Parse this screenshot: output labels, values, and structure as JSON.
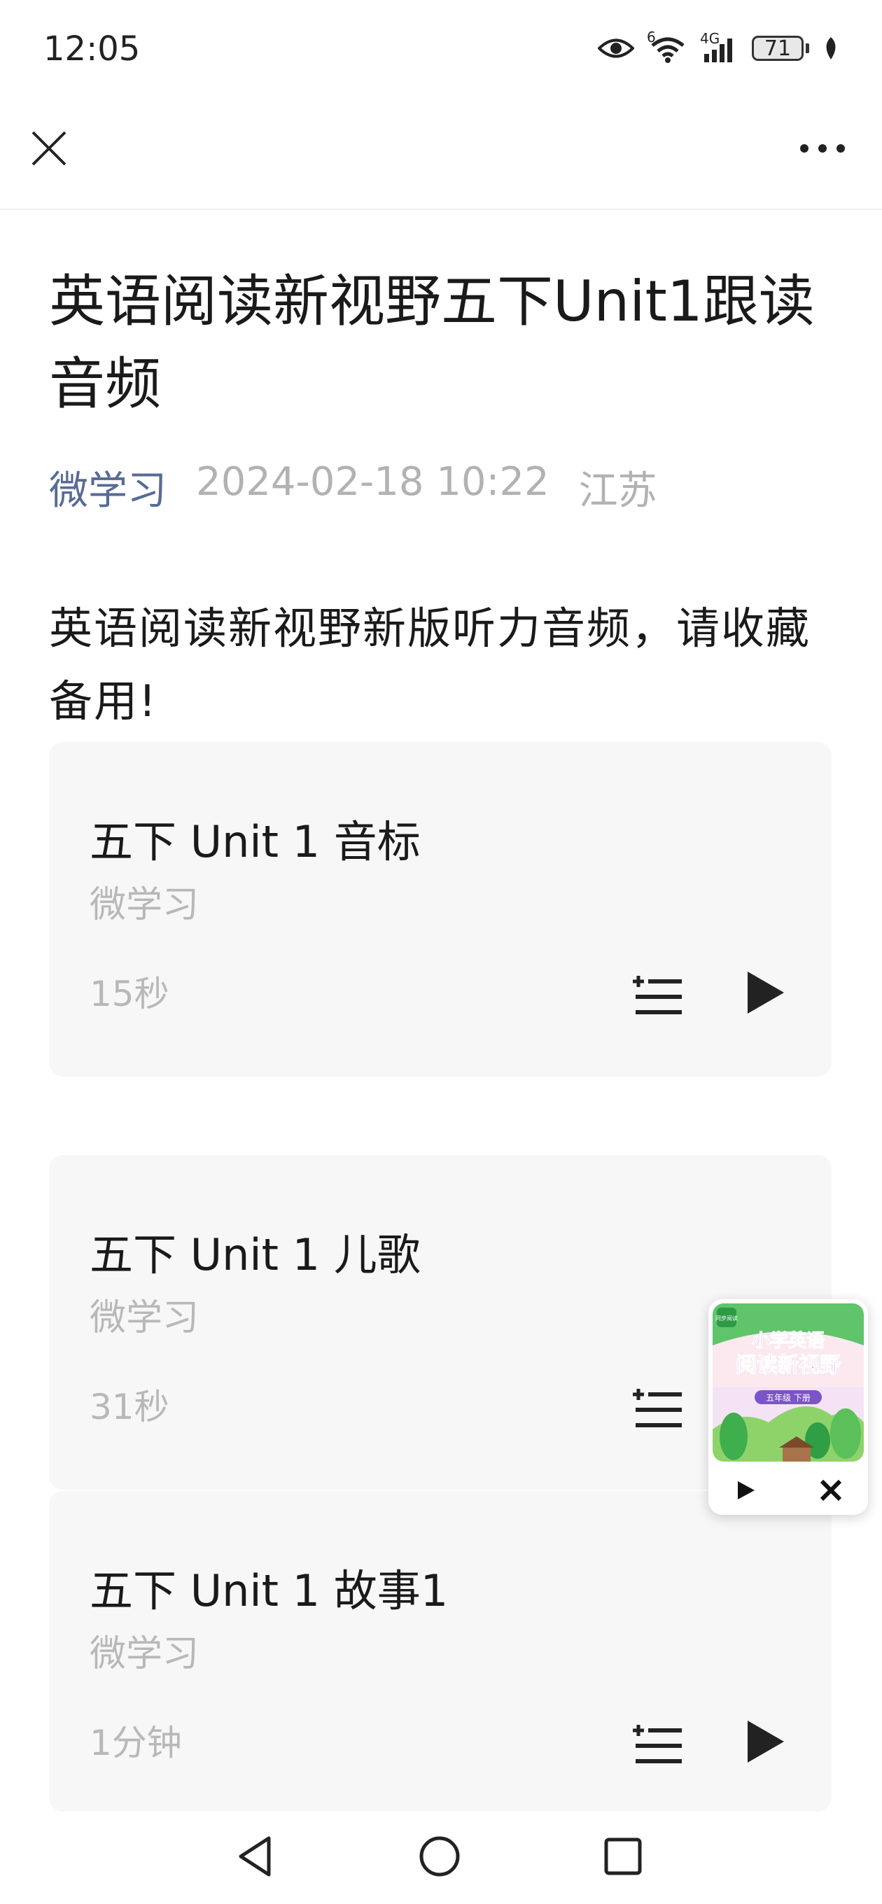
{
  "status": {
    "time": "12:05",
    "wifi_badge": "6",
    "network": "4G",
    "battery": "71",
    "icons": [
      "eye-icon",
      "wifi-icon",
      "signal-icon",
      "battery-icon",
      "leaf-icon"
    ]
  },
  "nav": {
    "close_icon": "close-icon",
    "more_icon": "more-icon"
  },
  "article": {
    "title": "英语阅读新视野五下Unit1跟读音频",
    "author": "微学习",
    "datetime": "2024-02-18 10:22",
    "location": "江苏",
    "intro": "英语阅读新视野新版听力音频，请收藏备用!"
  },
  "audios": [
    {
      "title": "五下 Unit 1 音标",
      "author": "微学习",
      "duration": "15秒"
    },
    {
      "title": "五下 Unit 1 儿歌",
      "author": "微学习",
      "duration": "31秒"
    },
    {
      "title": "五下 Unit 1 故事1",
      "author": "微学习",
      "duration": "1分钟"
    }
  ],
  "mini_player": {
    "cover_line1": "小学英语",
    "cover_line2": "阅读新视野",
    "cover_badge": "五年级 下册",
    "cover_corner": "同步阅读"
  },
  "colors": {
    "author_link": "#576b95",
    "meta_gray": "#b2b2b2",
    "card_bg": "#f7f7f7"
  }
}
